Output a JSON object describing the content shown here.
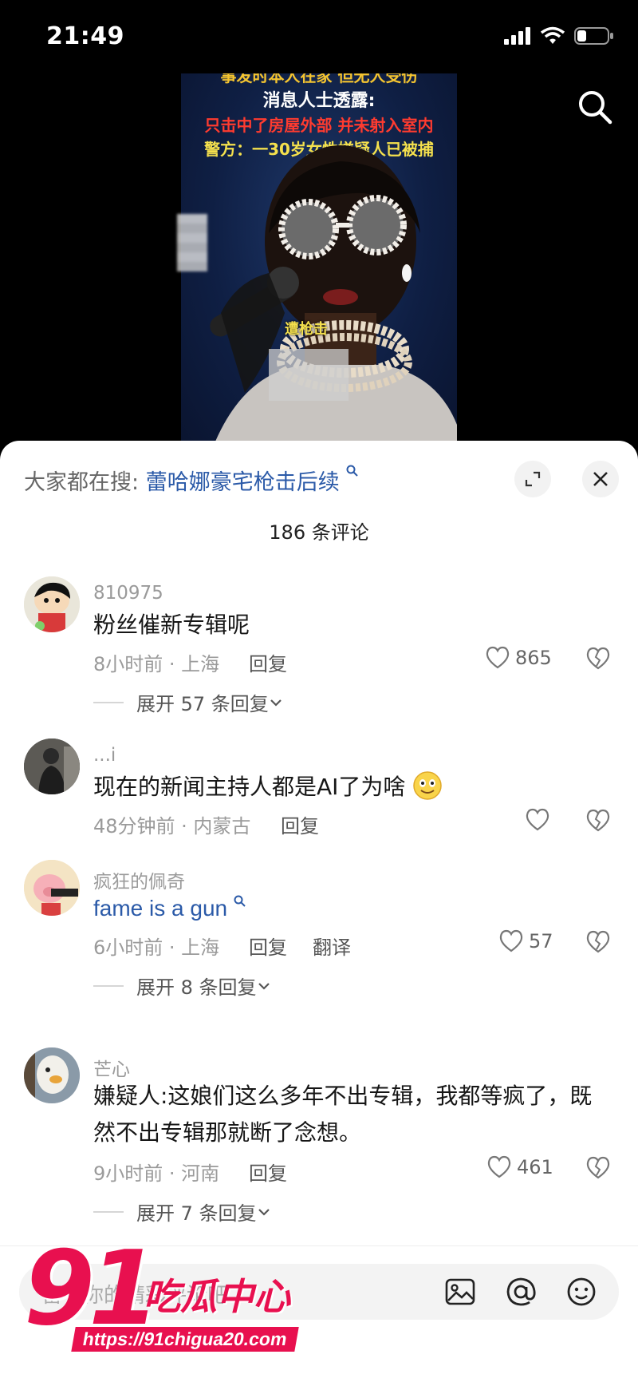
{
  "status": {
    "time": "21:49"
  },
  "video": {
    "headline_top": "事发时本人在家 但无人受伤",
    "headline_line2": "消息人士透露:",
    "headline_line3": "只击中了房屋外部 并未射入室内",
    "headline_line4": "警方：一30岁女性嫌疑人已被捕",
    "caption": "遭枪击"
  },
  "sheet": {
    "search_prefix": "大家都在搜:",
    "search_keyword": "蕾哈娜豪宅枪击后续",
    "comments_count": "186 条评论"
  },
  "comments": [
    {
      "user": "810975",
      "text": "粉丝催新专辑呢",
      "meta": "8小时前 · 上海",
      "reply": "回复",
      "likes": "865",
      "expand": "展开 57 条回复"
    },
    {
      "user": "...i",
      "text": "现在的新闻主持人都是AI了为啥",
      "meta": "48分钟前 · 内蒙古",
      "reply": "回复",
      "likes": ""
    },
    {
      "user": "疯狂的佩奇",
      "text": "fame is a gun",
      "meta": "6小时前 · 上海",
      "reply": "回复",
      "translate": "翻译",
      "likes": "57",
      "expand": "展开 8 条回复"
    },
    {
      "user": "芒心",
      "text_line1": "嫌疑人:这娘们这么多年不出专辑，我都等疯了，既",
      "text_line2": "然不出专辑那就断了念想。",
      "meta": "9小时前 · 河南",
      "reply": "回复",
      "likes": "461",
      "expand": "展开 7 条回复"
    }
  ],
  "input": {
    "placeholder": "留下你的精彩评论吧"
  },
  "watermark": {
    "number": "91",
    "brand": "吃瓜中心",
    "url": "https://91chigua20.com"
  }
}
